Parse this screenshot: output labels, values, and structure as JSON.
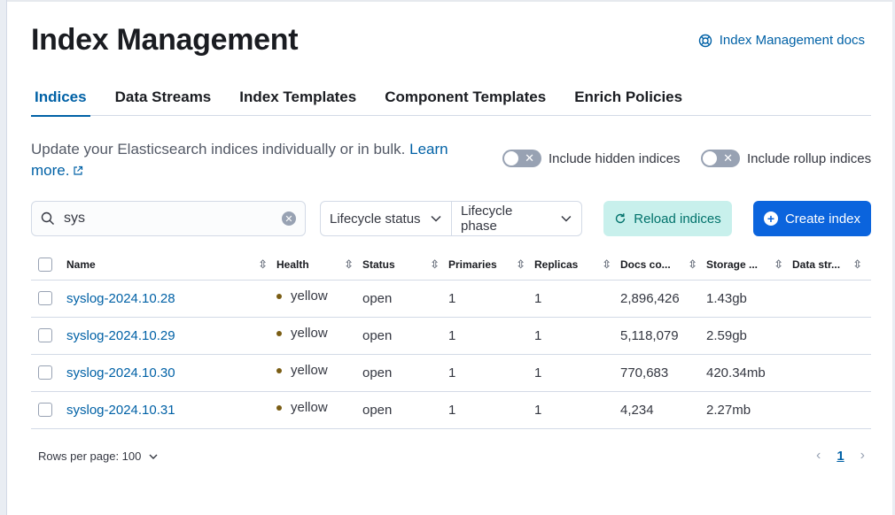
{
  "header": {
    "title": "Index Management",
    "docs_link": "Index Management docs"
  },
  "tabs": [
    {
      "label": "Indices",
      "active": true
    },
    {
      "label": "Data Streams"
    },
    {
      "label": "Index Templates"
    },
    {
      "label": "Component Templates"
    },
    {
      "label": "Enrich Policies"
    }
  ],
  "description": {
    "text": "Update your Elasticsearch indices individually or in bulk. ",
    "link_text": "Learn more."
  },
  "toggles": {
    "hidden": {
      "label": "Include hidden indices",
      "on": false
    },
    "rollup": {
      "label": "Include rollup indices",
      "on": false
    }
  },
  "search": {
    "value": "sys"
  },
  "filters": {
    "lifecycle_status": "Lifecycle status",
    "lifecycle_phase": "Lifecycle phase"
  },
  "buttons": {
    "reload": "Reload indices",
    "create": "Create index"
  },
  "table": {
    "columns": [
      "Name",
      "Health",
      "Status",
      "Primaries",
      "Replicas",
      "Docs co...",
      "Storage ...",
      "Data str..."
    ],
    "rows": [
      {
        "name": "syslog-2024.10.28",
        "health": "yellow",
        "status": "open",
        "primaries": "1",
        "replicas": "1",
        "docs": "2,896,426",
        "storage": "1.43gb",
        "data_stream": ""
      },
      {
        "name": "syslog-2024.10.29",
        "health": "yellow",
        "status": "open",
        "primaries": "1",
        "replicas": "1",
        "docs": "5,118,079",
        "storage": "2.59gb",
        "data_stream": ""
      },
      {
        "name": "syslog-2024.10.30",
        "health": "yellow",
        "status": "open",
        "primaries": "1",
        "replicas": "1",
        "docs": "770,683",
        "storage": "420.34mb",
        "data_stream": ""
      },
      {
        "name": "syslog-2024.10.31",
        "health": "yellow",
        "status": "open",
        "primaries": "1",
        "replicas": "1",
        "docs": "4,234",
        "storage": "2.27mb",
        "data_stream": ""
      }
    ]
  },
  "pagination": {
    "rows_per_page": "Rows per page: 100",
    "current_page": "1"
  },
  "colors": {
    "link": "#0061a6",
    "primary_button": "#0b64dd",
    "reload_bg": "#c8f0ec",
    "reload_text": "#00726b",
    "health_yellow": "#7a5d14"
  }
}
